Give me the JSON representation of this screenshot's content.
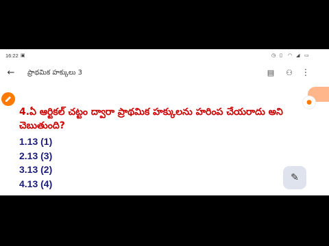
{
  "status_bar": {
    "time": "16:22",
    "icons": [
      "camera-icon",
      "alarm-icon",
      "vibrate-icon",
      "wifi-icon",
      "battery-icon"
    ]
  },
  "app_bar": {
    "title": "ప్రాథమిక హక్కులు 3",
    "icons": [
      "back-arrow-icon",
      "comment-icon",
      "account-icon",
      "more-vert-icon"
    ]
  },
  "content": {
    "question": "4.ఏ ఆర్టికల్ చట్టం ద్వారా ప్రాథమిక హక్కులను హరింప చేయరాదు అని చెబుతుంది?",
    "options": [
      "1.13 (1)",
      "2.13 (3)",
      "3.13 (2)",
      "4.13 (4)"
    ]
  },
  "colors": {
    "question": "#cc0000",
    "options": "#1a1a7a",
    "accent": "#ff7a00",
    "fab": "#dfe3ee"
  }
}
